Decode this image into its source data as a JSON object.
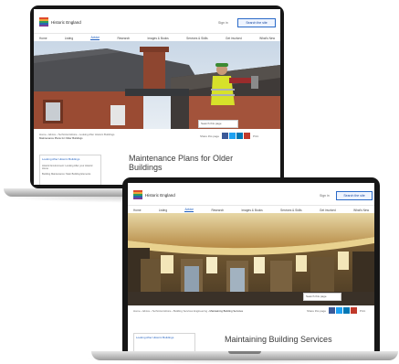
{
  "brand": {
    "logo_text": "Historic England",
    "flag_colors": [
      "#e04a2c",
      "#f0a53a",
      "#2e9d5a",
      "#2867b2",
      "#7a3d96"
    ]
  },
  "header": {
    "sign_in": "Sign in",
    "search_button": "Search the site"
  },
  "nav": {
    "items": [
      "Home",
      "Listing",
      "Advice",
      "Research",
      "Images & Books",
      "Services & Skills",
      "Get involved",
      "What's New"
    ],
    "active": "Advice"
  },
  "share": {
    "label": "Share this page",
    "buttons": [
      {
        "icon": "facebook-icon",
        "color": "#3b5998"
      },
      {
        "icon": "twitter-icon",
        "color": "#1da1f2"
      },
      {
        "icon": "linkedin-icon",
        "color": "#0077b5"
      },
      {
        "icon": "email-icon",
        "color": "#c0392b"
      }
    ],
    "print": "Print"
  },
  "search_page": "Search this page",
  "page1": {
    "breadcrumb": [
      "Home",
      "Advice",
      "Technical Advice",
      "Looking After Historic Buildings",
      "Maintenance Plans for Older Buildings"
    ],
    "title": "Maintenance Plans for Older Buildings",
    "sidebar_title": "Looking After Historic Buildings",
    "sidebar_items": [
      "Historic Environment: Looking After your Historic Home",
      "Building Maintenance: Main Building Elements"
    ]
  },
  "page2": {
    "breadcrumb": [
      "Home",
      "Advice",
      "Technical Advice",
      "Building Services Engineering",
      "Maintaining Building Services"
    ],
    "title": "Maintaining Building Services",
    "sidebar_title": "Looking After Historic Buildings"
  }
}
